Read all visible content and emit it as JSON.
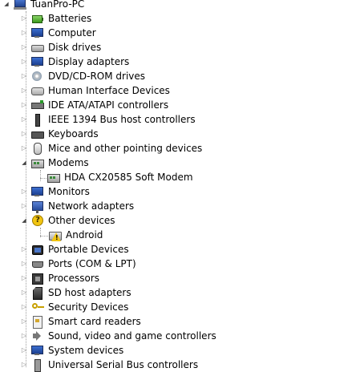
{
  "tree": {
    "root": {
      "label": "TuanPro-PC",
      "icon": "computer-icon",
      "expanded": true
    },
    "items": [
      {
        "label": "Batteries",
        "icon": "battery-icon",
        "expanded": false
      },
      {
        "label": "Computer",
        "icon": "computer-monitor-icon",
        "expanded": false
      },
      {
        "label": "Disk drives",
        "icon": "disk-drive-icon",
        "expanded": false
      },
      {
        "label": "Display adapters",
        "icon": "display-adapter-icon",
        "expanded": false
      },
      {
        "label": "DVD/CD-ROM drives",
        "icon": "dvd-drive-icon",
        "expanded": false
      },
      {
        "label": "Human Interface Devices",
        "icon": "hid-icon",
        "expanded": false
      },
      {
        "label": "IDE ATA/ATAPI controllers",
        "icon": "ide-controller-icon",
        "expanded": false
      },
      {
        "label": "IEEE 1394 Bus host controllers",
        "icon": "firewire-icon",
        "expanded": false
      },
      {
        "label": "Keyboards",
        "icon": "keyboard-icon",
        "expanded": false
      },
      {
        "label": "Mice and other pointing devices",
        "icon": "mouse-icon",
        "expanded": false
      },
      {
        "label": "Modems",
        "icon": "modem-icon",
        "expanded": true,
        "children": [
          {
            "label": "HDA CX20585 Soft Modem",
            "icon": "modem-icon"
          }
        ]
      },
      {
        "label": "Monitors",
        "icon": "monitor-icon",
        "expanded": false
      },
      {
        "label": "Network adapters",
        "icon": "network-adapter-icon",
        "expanded": false
      },
      {
        "label": "Other devices",
        "icon": "unknown-device-icon",
        "expanded": true,
        "children": [
          {
            "label": "Android",
            "icon": "warning-device-icon"
          }
        ]
      },
      {
        "label": "Portable Devices",
        "icon": "portable-device-icon",
        "expanded": false
      },
      {
        "label": "Ports (COM & LPT)",
        "icon": "port-icon",
        "expanded": false
      },
      {
        "label": "Processors",
        "icon": "processor-icon",
        "expanded": false
      },
      {
        "label": "SD host adapters",
        "icon": "sd-card-icon",
        "expanded": false
      },
      {
        "label": "Security Devices",
        "icon": "security-key-icon",
        "expanded": false
      },
      {
        "label": "Smart card readers",
        "icon": "smart-card-icon",
        "expanded": false
      },
      {
        "label": "Sound, video and game controllers",
        "icon": "speaker-icon",
        "expanded": false
      },
      {
        "label": "System devices",
        "icon": "system-device-icon",
        "expanded": false
      },
      {
        "label": "Universal Serial Bus controllers",
        "icon": "usb-icon",
        "expanded": false
      }
    ]
  }
}
